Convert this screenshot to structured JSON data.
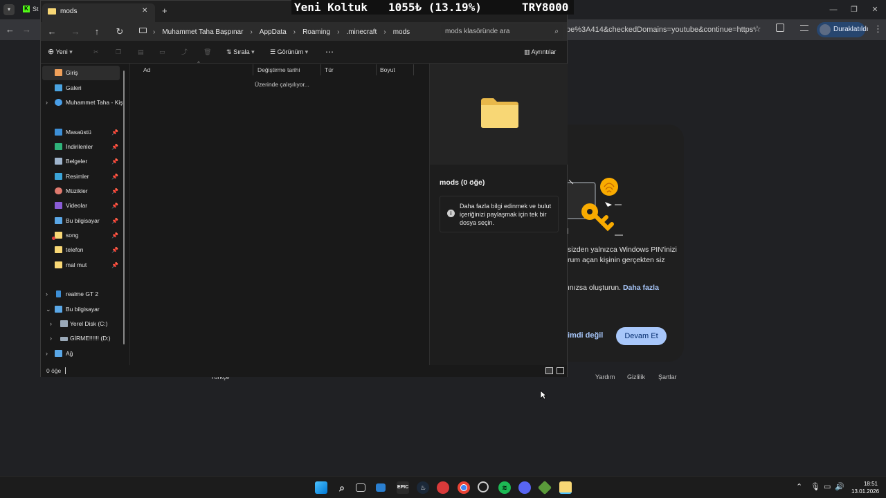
{
  "browser": {
    "url_tail": "be%3A414&checkedDomains=youtube&continue=https%3A...",
    "profile_label": "Duraklatıldı",
    "tab_label_fragment": "St"
  },
  "google_dialog": {
    "text_line1": "sizden yalnızca Windows PIN'inizi",
    "text_line2": "rum açan kişinin gerçekten siz",
    "text_line3_prefix": "ınızsa oluşturun.",
    "more_link": "Daha fazla",
    "not_now": "imdi değil",
    "continue": "Devam Et",
    "footer": {
      "language": "Türkçe",
      "help": "Yardım",
      "privacy": "Gizlilik",
      "terms": "Şartlar"
    }
  },
  "overlay": {
    "title": "Yeni Koltuk",
    "amount": "1055₺ (13.19%)",
    "goal": "TRY8000"
  },
  "explorer": {
    "tab_title": "mods",
    "breadcrumb": [
      "Muhammet Taha Başpınar",
      "AppData",
      "Roaming",
      ".minecraft",
      "mods"
    ],
    "search_placeholder": "mods klasöründe ara",
    "cmd": {
      "new": "Yeni",
      "sort": "Sırala",
      "view": "Görünüm",
      "details": "Ayrıntılar"
    },
    "sidebar": {
      "home": "Giriş",
      "gallery": "Galeri",
      "onedrive": "Muhammet Taha - Kiş",
      "desktop": "Masaüstü",
      "downloads": "İndirilenler",
      "documents": "Belgeler",
      "pictures": "Resimler",
      "music": "Müzikler",
      "videos": "Videolar",
      "this_pc_pinned": "Bu bilgisayar",
      "song": "song",
      "telefon": "telefon",
      "malmut": "mal mut",
      "realme": "realme GT 2",
      "this_pc": "Bu bilgisayar",
      "local_disk": "Yerel Disk (C:)",
      "girme": "GİRME!!!!!! (D:)",
      "network": "Ağ"
    },
    "columns": {
      "name": "Ad",
      "modified": "Değiştirme tarihi",
      "type": "Tür",
      "size": "Boyut"
    },
    "working_text": "Üzerinde çalışılıyor...",
    "details": {
      "title": "mods (0 öğe)",
      "info_text": "Daha fazla bilgi edinmek ve bulut içeriğinizi paylaşmak için tek bir dosya seçin."
    },
    "status_count": "0 öğe"
  },
  "taskbar": {
    "time": "18:51",
    "date": "13.01.2026"
  }
}
